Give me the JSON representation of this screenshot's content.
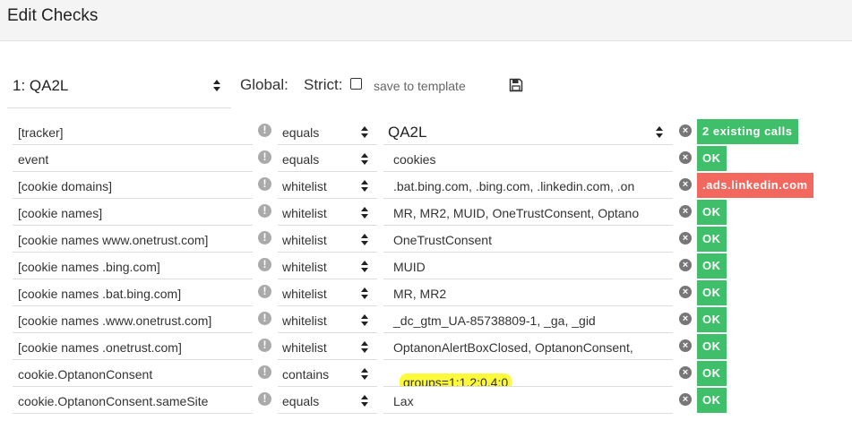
{
  "header": {
    "title": "Edit Checks"
  },
  "toolbar": {
    "profile_value": "1: QA2L",
    "global_label": "Global:",
    "strict_label": "Strict:",
    "save_template_label": "save to template"
  },
  "colors": {
    "ok": "#3fbf6a",
    "fail": "#f2675e",
    "highlight": "#fdfa3b"
  },
  "checks": [
    {
      "name": "[tracker]",
      "operator": "equals",
      "value": "QA2L",
      "value_is_select": true,
      "status": "2 existing calls",
      "status_type": "info"
    },
    {
      "name": "event",
      "operator": "equals",
      "value": "cookies",
      "status": "OK",
      "status_type": "ok"
    },
    {
      "name": "[cookie domains]",
      "operator": "whitelist",
      "value": ".bat.bing.com, .bing.com, .linkedin.com, .on",
      "status": ".ads.linkedin.com",
      "status_type": "fail"
    },
    {
      "name": "[cookie names]",
      "operator": "whitelist",
      "value": "MR, MR2, MUID, OneTrustConsent, Optano",
      "status": "OK",
      "status_type": "ok"
    },
    {
      "name": "[cookie names www.onetrust.com]",
      "operator": "whitelist",
      "value": "OneTrustConsent",
      "status": "OK",
      "status_type": "ok"
    },
    {
      "name": "[cookie names .bing.com]",
      "operator": "whitelist",
      "value": "MUID",
      "status": "OK",
      "status_type": "ok"
    },
    {
      "name": "[cookie names .bat.bing.com]",
      "operator": "whitelist",
      "value": "MR, MR2",
      "status": "OK",
      "status_type": "ok"
    },
    {
      "name": "[cookie names .www.onetrust.com]",
      "operator": "whitelist",
      "value": "_dc_gtm_UA-85738809-1, _ga, _gid",
      "status": "OK",
      "status_type": "ok"
    },
    {
      "name": "[cookie names .onetrust.com]",
      "operator": "whitelist",
      "value": "OptanonAlertBoxClosed, OptanonConsent,",
      "status": "OK",
      "status_type": "ok"
    },
    {
      "name": "cookie.OptanonConsent",
      "operator": "contains",
      "value": "groups=1:1,2:0,4:0",
      "value_highlighted": true,
      "status": "OK",
      "status_type": "ok"
    },
    {
      "name": "cookie.OptanonConsent.sameSite",
      "operator": "equals",
      "value": "Lax",
      "status": "OK",
      "status_type": "ok"
    }
  ]
}
